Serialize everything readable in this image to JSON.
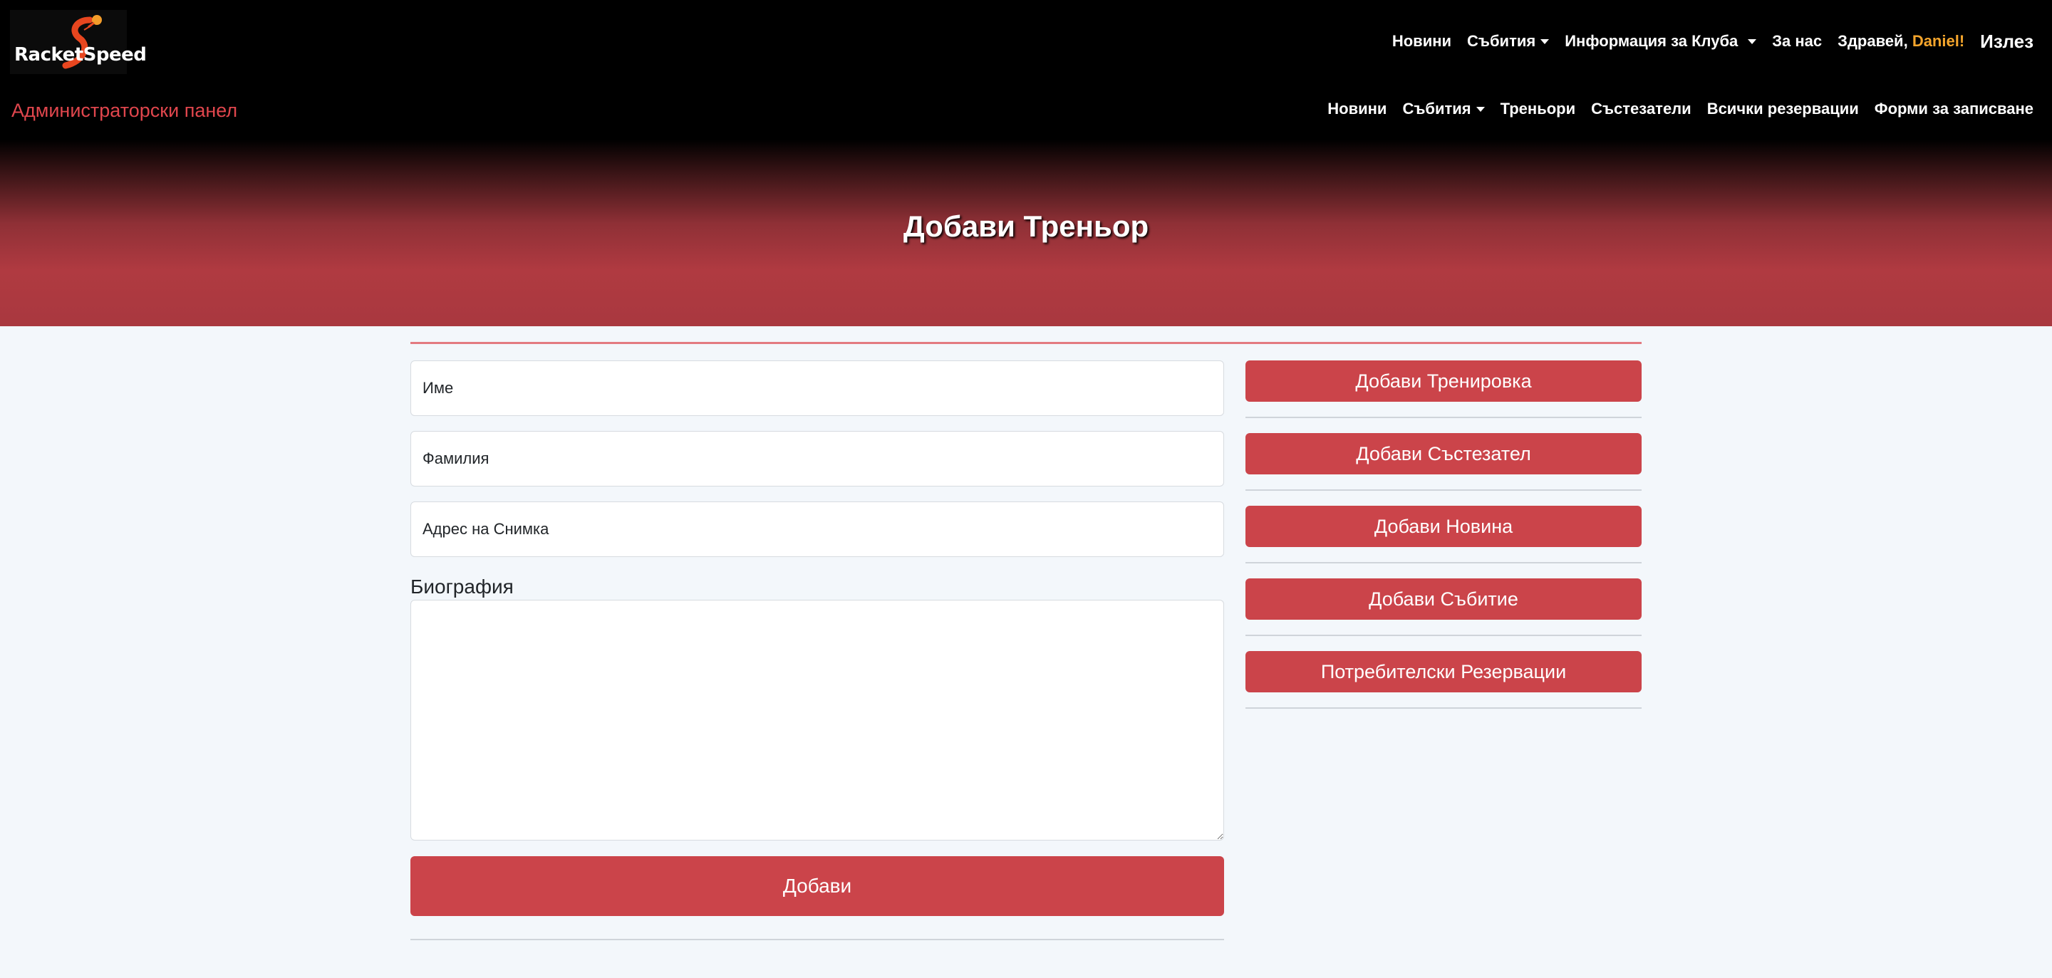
{
  "brand": {
    "logo_text": "RacketSpeed"
  },
  "top_nav": {
    "items": [
      {
        "label": "Новини",
        "dropdown": false
      },
      {
        "label": "Събития",
        "dropdown": true
      },
      {
        "label": "Информация за Клуба",
        "dropdown": true
      },
      {
        "label": "За нас",
        "dropdown": false
      }
    ],
    "greeting": "Здравей,",
    "user_name": "Daniel!",
    "logout_label": "Излез"
  },
  "admin_nav": {
    "title": "Администраторски панел",
    "items": [
      {
        "label": "Новини",
        "dropdown": false
      },
      {
        "label": "Събития",
        "dropdown": true
      },
      {
        "label": "Треньори",
        "dropdown": false
      },
      {
        "label": "Състезатели",
        "dropdown": false
      },
      {
        "label": "Всички резервации",
        "dropdown": false
      },
      {
        "label": "Форми за записване",
        "dropdown": false
      }
    ]
  },
  "hero": {
    "title": "Добави Треньор"
  },
  "form": {
    "first_name_placeholder": "Име",
    "last_name_placeholder": "Фамилия",
    "photo_url_placeholder": "Адрес на Снимка",
    "bio_label": "Биография",
    "bio_value": "",
    "submit_label": "Добави"
  },
  "sidebar": {
    "buttons": [
      {
        "label": "Добави Тренировка"
      },
      {
        "label": "Добави Състезател"
      },
      {
        "label": "Добави Новина"
      },
      {
        "label": "Добави Събитие"
      },
      {
        "label": "Потребителски Резервации"
      }
    ]
  },
  "colors": {
    "accent": "#cb444a",
    "admin_title": "#e0464d",
    "user_name": "#f4a52c",
    "background": "#f3f7fb"
  }
}
